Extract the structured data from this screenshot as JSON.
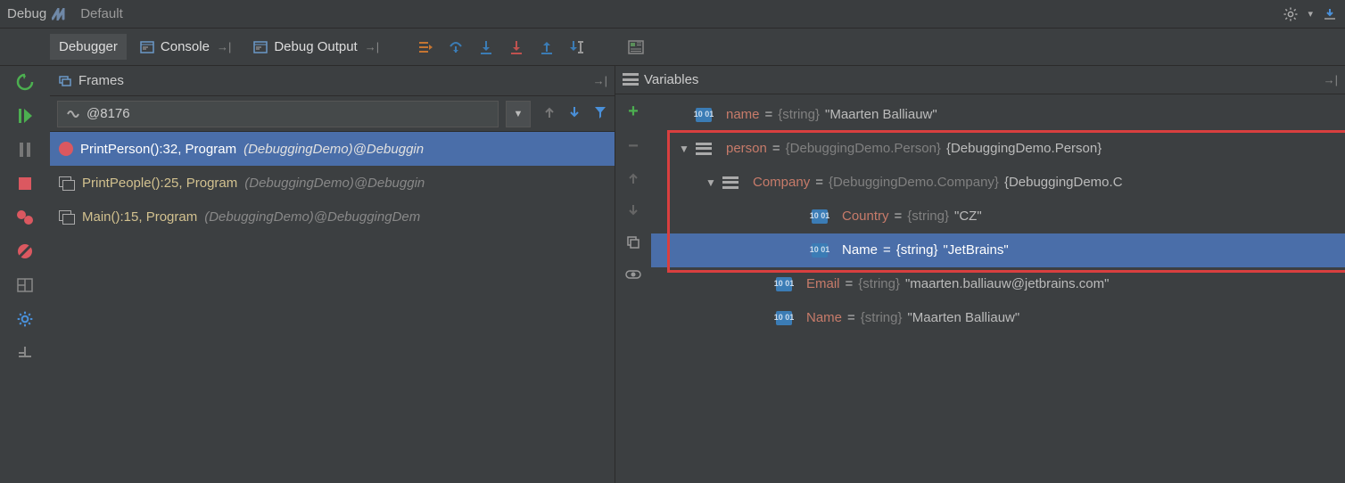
{
  "titlebar": {
    "label": "Debug",
    "config": "Default"
  },
  "tabs": {
    "debugger": "Debugger",
    "console": "Console",
    "debug_output": "Debug Output"
  },
  "frames": {
    "title": "Frames",
    "thread": "@8176",
    "items": [
      {
        "method": "PrintPerson():32, Program ",
        "module": "(DebuggingDemo)@Debuggin",
        "selected": true,
        "bp": true
      },
      {
        "method": "PrintPeople():25, Program ",
        "module": "(DebuggingDemo)@Debuggin",
        "selected": false,
        "bp": false
      },
      {
        "method": "Main():15, Program ",
        "module": "(DebuggingDemo)@DebuggingDem",
        "selected": false,
        "bp": false
      }
    ]
  },
  "variables": {
    "title": "Variables",
    "rows": [
      {
        "indent": 0,
        "tri": "",
        "icon": "str",
        "name": "name",
        "eq": " = ",
        "type": "{string}",
        "val": " \"Maarten Balliauw\"",
        "sel": false
      },
      {
        "indent": 0,
        "tri": "▼",
        "icon": "obj",
        "name": "person",
        "eq": " = ",
        "type": "{DebuggingDemo.Person}",
        "val": " {DebuggingDemo.Person}",
        "sel": false
      },
      {
        "indent": 1,
        "tri": "▼",
        "icon": "obj",
        "name": "Company",
        "eq": " = ",
        "type": "{DebuggingDemo.Company}",
        "val": " {DebuggingDemo.C",
        "sel": false
      },
      {
        "indent": 3,
        "tri": "",
        "icon": "str",
        "name": "Country",
        "eq": " = ",
        "type": "{string}",
        "val": " \"CZ\"",
        "sel": false
      },
      {
        "indent": 3,
        "tri": "",
        "icon": "str",
        "name": "Name",
        "eq": " = ",
        "type": "{string}",
        "val": " \"JetBrains\"",
        "sel": true
      },
      {
        "indent": 2,
        "tri": "",
        "icon": "str",
        "name": "Email",
        "eq": " = ",
        "type": "{string}",
        "val": " \"maarten.balliauw@jetbrains.com\"",
        "sel": false
      },
      {
        "indent": 2,
        "tri": "",
        "icon": "str",
        "name": "Name",
        "eq": " = ",
        "type": "{string}",
        "val": " \"Maarten Balliauw\"",
        "sel": false
      }
    ]
  }
}
